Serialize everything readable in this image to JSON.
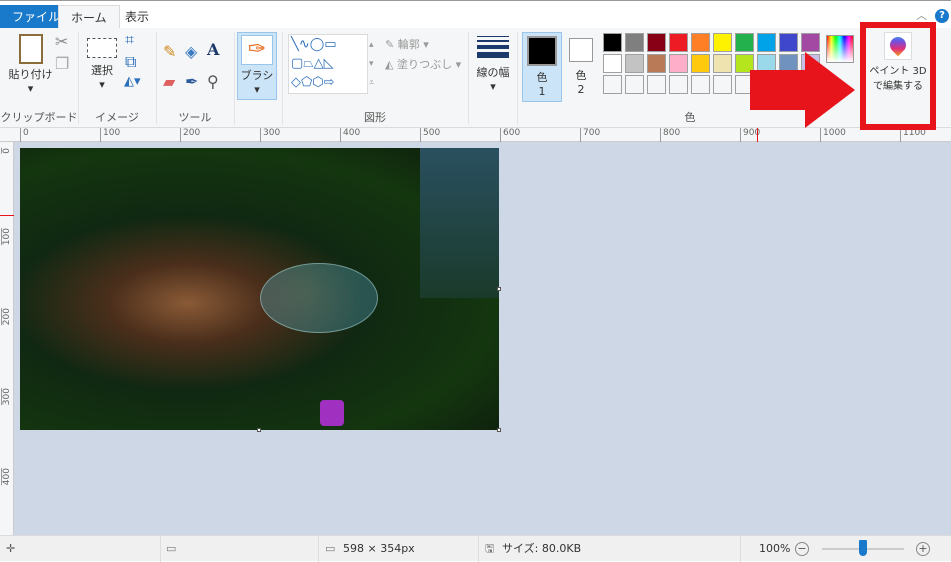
{
  "tabs": {
    "file": "ファイル",
    "home": "ホーム",
    "view": "表示"
  },
  "clipboard": {
    "paste": "貼り付け",
    "group": "クリップボード"
  },
  "image": {
    "select": "選択",
    "group": "イメージ"
  },
  "tools": {
    "group": "ツール"
  },
  "brush": {
    "label": "ブラシ"
  },
  "shapes": {
    "outline": "輪郭",
    "fill": "塗りつぶし",
    "group": "図形"
  },
  "size": {
    "label": "線の幅"
  },
  "colors": {
    "color1": "色",
    "color1_num": "1",
    "color2": "色",
    "color2_num": "2",
    "group": "色",
    "palette_row1": [
      "#000000",
      "#7f7f7f",
      "#880015",
      "#ed1c24",
      "#ff7f27",
      "#fff200",
      "#22b14c",
      "#00a2e8",
      "#3f48cc",
      "#a349a4"
    ],
    "palette_row2": [
      "#ffffff",
      "#c3c3c3",
      "#b97a57",
      "#ffaec9",
      "#ffc90e",
      "#efe4b0",
      "#b5e61d",
      "#99d9ea",
      "#7092be",
      "#c8bfe7"
    ]
  },
  "paint3d": {
    "line1": "ペイント 3D",
    "line2": "で編集する"
  },
  "ruler": {
    "h": [
      "0",
      "100",
      "200",
      "300",
      "400",
      "500",
      "600",
      "700",
      "800",
      "900",
      "1000",
      "1100"
    ],
    "v": [
      "0",
      "100",
      "200",
      "300",
      "400"
    ]
  },
  "status": {
    "dimensions": "598 × 354px",
    "size": "サイズ: 80.0KB",
    "zoom": "100%",
    "zoom_fraction": 0.5
  },
  "highlight_color": "#e8141c"
}
